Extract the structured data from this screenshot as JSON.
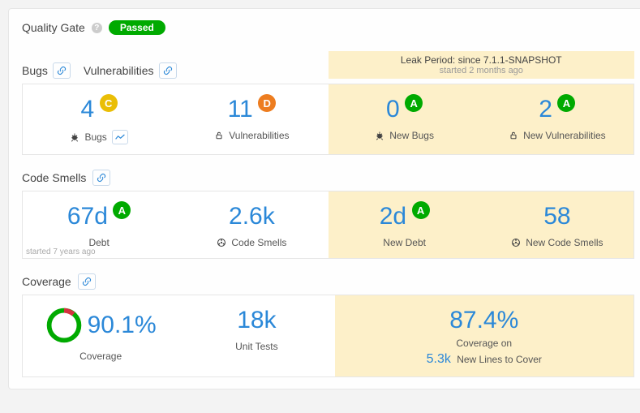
{
  "qualityGate": {
    "label": "Quality Gate",
    "status": "Passed",
    "statusColor": "#00aa00"
  },
  "leakPeriod": {
    "line1": "Leak Period: since 7.1.1-SNAPSHOT",
    "line2": "started 2 months ago"
  },
  "startedNote": "started 7 years ago",
  "sections": {
    "reliability": {
      "hdrBugs": "Bugs",
      "hdrVuln": "Vulnerabilities",
      "bugs": {
        "value": "4",
        "rating": "C",
        "label": "Bugs"
      },
      "vuln": {
        "value": "11",
        "rating": "D",
        "label": "Vulnerabilities"
      },
      "newBugs": {
        "value": "0",
        "rating": "A",
        "label": "New Bugs"
      },
      "newVuln": {
        "value": "2",
        "rating": "A",
        "label": "New Vulnerabilities"
      }
    },
    "maintainability": {
      "hdr": "Code Smells",
      "debt": {
        "value": "67d",
        "rating": "A",
        "label": "Debt"
      },
      "smells": {
        "value": "2.6k",
        "label": "Code Smells"
      },
      "newDebt": {
        "value": "2d",
        "rating": "A",
        "label": "New Debt"
      },
      "newSmells": {
        "value": "58",
        "label": "New Code Smells"
      }
    },
    "coverage": {
      "hdr": "Coverage",
      "cov": {
        "value": "90.1%",
        "label": "Coverage"
      },
      "tests": {
        "value": "18k",
        "label": "Unit Tests"
      },
      "newCov": {
        "value": "87.4%",
        "label1": "Coverage on",
        "linesValue": "5.3k",
        "label2": "New Lines to Cover"
      }
    }
  }
}
